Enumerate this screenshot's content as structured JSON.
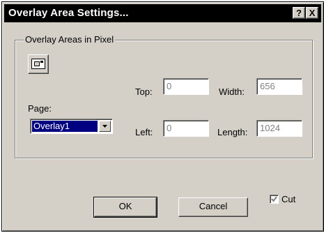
{
  "window": {
    "title": "Overlay Area Settings...",
    "help_label": "?",
    "close_label": "X"
  },
  "group": {
    "label": "Overlay  Areas in Pixel"
  },
  "page": {
    "label": "Page:",
    "selected": "Overlay1"
  },
  "fields": {
    "top": {
      "label": "Top:",
      "value": "0"
    },
    "width": {
      "label": "Width:",
      "value": "656"
    },
    "left": {
      "label": "Left:",
      "value": "0"
    },
    "length": {
      "label": "Length:",
      "value": "1024"
    }
  },
  "buttons": {
    "ok": "OK",
    "cancel": "Cancel"
  },
  "cut": {
    "label": "Cut",
    "checked": true
  },
  "icons": {
    "overlay_area": "overlay-area-icon",
    "dropdown": "chevron-down-icon",
    "check": "check-icon"
  },
  "colors": {
    "dialog_bg": "#d4d0c8",
    "titlebar_bg": "#000000",
    "selection": "#000080",
    "disabled_text": "#808080"
  }
}
